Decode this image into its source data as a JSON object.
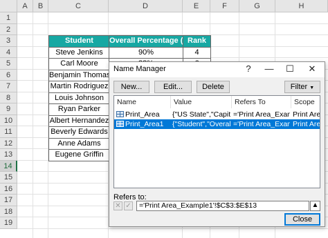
{
  "columns": [
    "A",
    "B",
    "C",
    "D",
    "E",
    "F",
    "G",
    "H"
  ],
  "rows": [
    "1",
    "2",
    "3",
    "4",
    "5",
    "6",
    "7",
    "8",
    "9",
    "10",
    "11",
    "12",
    "13",
    "14",
    "15",
    "16",
    "17",
    "18",
    "19"
  ],
  "selected_row": "14",
  "table": {
    "headers": [
      "Student",
      "Overall Percentage (%)",
      "Rank"
    ],
    "rows": [
      [
        "Steve Jenkins",
        "90%",
        "4"
      ],
      [
        "Carl Moore",
        "88%",
        "6"
      ],
      [
        "Benjamin Thomas",
        "",
        ""
      ],
      [
        "Martin Rodriguez",
        "",
        ""
      ],
      [
        "Louis Johnson",
        "",
        ""
      ],
      [
        "Ryan Parker",
        "",
        ""
      ],
      [
        "Albert Hernandez",
        "",
        ""
      ],
      [
        "Beverly Edwards",
        "",
        ""
      ],
      [
        "Anne Adams",
        "",
        ""
      ],
      [
        "Eugene Griffin",
        "",
        ""
      ]
    ],
    "header_color": "#17a8a3"
  },
  "dialog": {
    "title": "Name Manager",
    "help_label": "?",
    "close_label": "✕",
    "max_label": "☐",
    "min_label": "—",
    "buttons": {
      "new": "New...",
      "edit": "Edit...",
      "delete": "Delete",
      "filter": "Filter"
    },
    "list_headers": {
      "name": "Name",
      "value": "Value",
      "refers_to": "Refers To",
      "scope": "Scope"
    },
    "items": [
      {
        "name": "Print_Area",
        "value": "{\"US State\",\"Capital...",
        "refers_to": "='Print Area_Example...",
        "scope": "Print Area..."
      },
      {
        "name": "Print_Area1",
        "value": "{\"Student\",\"Overall ...",
        "refers_to": "='Print Area_Examp...",
        "scope": "Print Area..."
      }
    ],
    "selected_index": 1,
    "refers_to_label": "Refers to:",
    "refers_to_value": "='Print Area_Example1'!$C$3:$E$13",
    "close_button": "Close",
    "accent": "#0078d7"
  }
}
